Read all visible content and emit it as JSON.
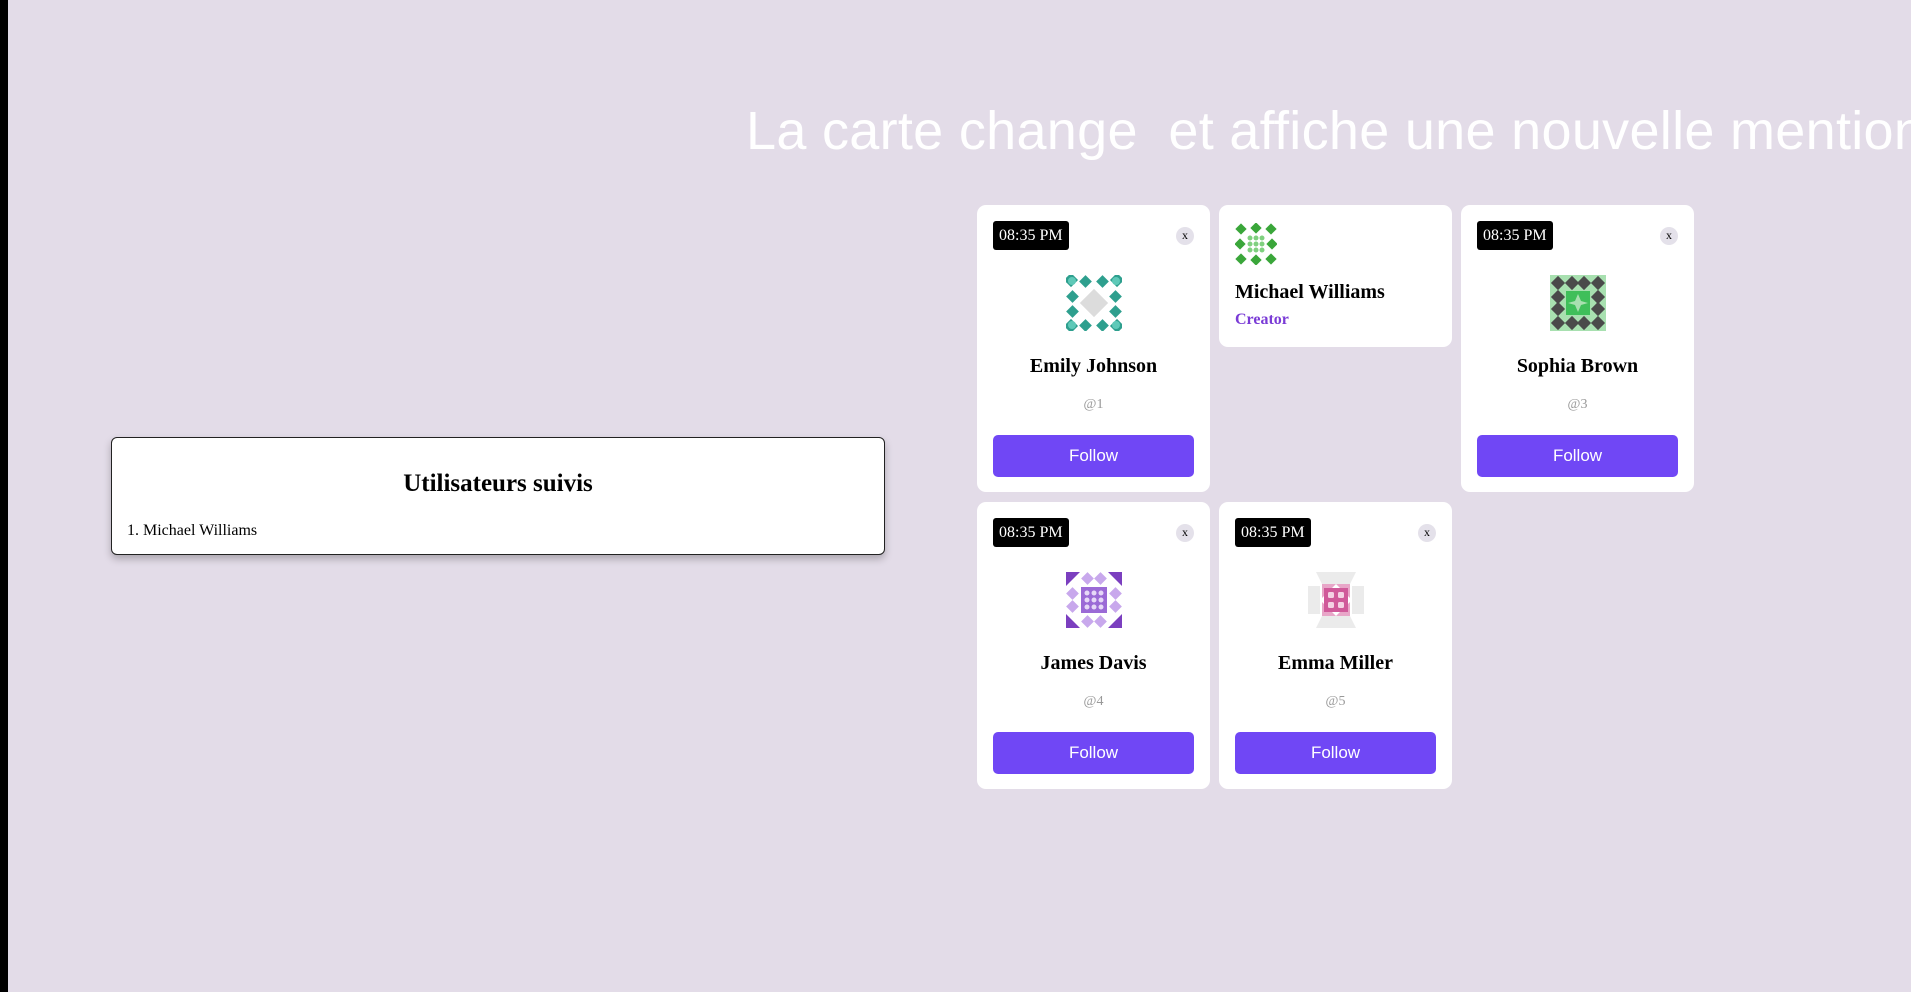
{
  "heading": "La carte change  et affiche une nouvelle mention",
  "followed_panel": {
    "title": "Utilisateurs suivis",
    "items": [
      "1. Michael Williams"
    ]
  },
  "cards": [
    {
      "time": "08:35 PM",
      "close": "x",
      "name": "Emily Johnson",
      "handle": "@1",
      "follow": "Follow",
      "avatar_color": "#2e9f8e"
    },
    {
      "time": "08:35 PM",
      "close": "x",
      "name": "Sophia Brown",
      "handle": "@3",
      "follow": "Follow",
      "avatar_color": "#4a4a4a"
    },
    {
      "time": "08:35 PM",
      "close": "x",
      "name": "James Davis",
      "handle": "@4",
      "follow": "Follow",
      "avatar_color": "#7b3fbf"
    },
    {
      "time": "08:35 PM",
      "close": "x",
      "name": "Emma Miller",
      "handle": "@5",
      "follow": "Follow",
      "avatar_color": "#d05a9a"
    }
  ],
  "creator_card": {
    "name": "Michael Williams",
    "role": "Creator",
    "avatar_color": "#3aa63a"
  },
  "colors": {
    "background": "#e3dce8",
    "accent": "#7047f5",
    "creator_role": "#7a3bd6"
  }
}
